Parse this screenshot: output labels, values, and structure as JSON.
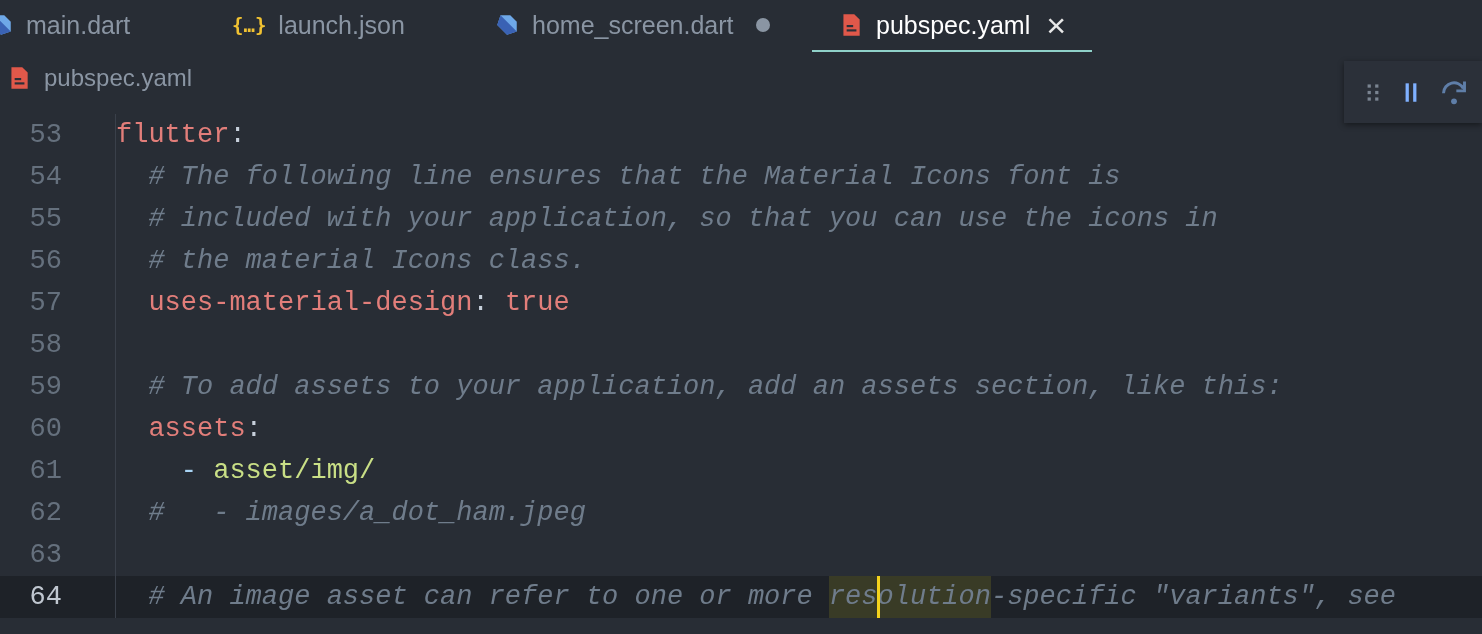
{
  "tabs": [
    {
      "label": "main.dart",
      "kind": "dart",
      "selected": false,
      "modified": false
    },
    {
      "label": "launch.json",
      "kind": "json",
      "glyph": "{…}",
      "selected": false,
      "modified": false
    },
    {
      "label": "home_screen.dart",
      "kind": "dart",
      "selected": false,
      "modified": true
    },
    {
      "label": "pubspec.yaml",
      "kind": "yaml",
      "selected": true,
      "modified": false,
      "close_glyph": "×"
    }
  ],
  "breadcrumb": {
    "label": "pubspec.yaml",
    "kind": "yaml"
  },
  "editor": {
    "lines": [
      {
        "number": "53",
        "current": false,
        "segments": [
          {
            "text": "flutter",
            "kind": "key"
          },
          {
            "text": ":",
            "kind": "punct"
          }
        ]
      },
      {
        "number": "54",
        "current": false,
        "segments": [
          {
            "text": "  # The following line ensures that the Material Icons font is",
            "kind": "comment"
          }
        ]
      },
      {
        "number": "55",
        "current": false,
        "segments": [
          {
            "text": "  # included with your application, so that you can use the icons in",
            "kind": "comment"
          }
        ]
      },
      {
        "number": "56",
        "current": false,
        "segments": [
          {
            "text": "  # the material Icons class.",
            "kind": "comment"
          }
        ]
      },
      {
        "number": "57",
        "current": false,
        "segments": [
          {
            "text": "  uses-material-design",
            "kind": "key"
          },
          {
            "text": ": ",
            "kind": "punct"
          },
          {
            "text": "true",
            "kind": "value"
          }
        ]
      },
      {
        "number": "58",
        "current": false
      },
      {
        "number": "59",
        "current": false,
        "segments": [
          {
            "text": "  # To add assets to your application, add an assets section, like this:",
            "kind": "comment"
          }
        ]
      },
      {
        "number": "60",
        "current": false,
        "segments": [
          {
            "text": "  assets",
            "kind": "key"
          },
          {
            "text": ":",
            "kind": "punct"
          }
        ]
      },
      {
        "number": "61",
        "current": false,
        "segments": [
          {
            "text": "    - ",
            "kind": "dash"
          },
          {
            "text": "asset/img/",
            "kind": "string"
          }
        ]
      },
      {
        "number": "62",
        "current": false,
        "segments": [
          {
            "text": "  #   - images/a_dot_ham.jpeg",
            "kind": "comment"
          }
        ]
      },
      {
        "number": "63",
        "current": false
      },
      {
        "number": "64",
        "current": true,
        "segments": [
          {
            "text": "  # An image asset can refer to one or more ",
            "kind": "comment"
          },
          {
            "text": "res",
            "kind": "match"
          },
          {
            "text": "olution",
            "kind": "match",
            "caret": true
          },
          {
            "text": "-specific \"variants\", see",
            "kind": "comment"
          }
        ]
      }
    ]
  }
}
